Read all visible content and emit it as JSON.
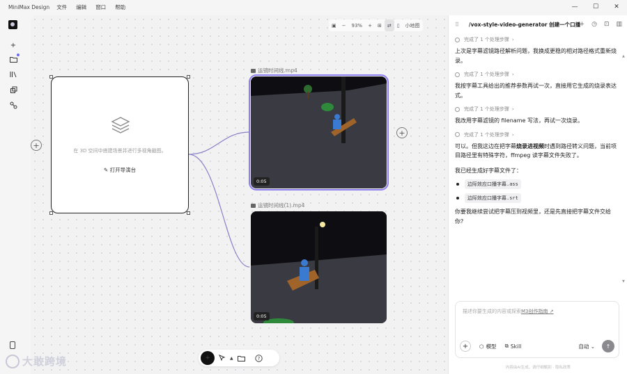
{
  "titlebar": {
    "app_name": "MiniMax Design",
    "menu": [
      "文件",
      "编辑",
      "窗口",
      "帮助"
    ],
    "controls": {
      "minimize": "—",
      "maximize": "☐",
      "close": "✕"
    }
  },
  "rail": {
    "icons": [
      "add-icon",
      "folder-icon",
      "library-icon",
      "puzzle-icon",
      "nodes-icon",
      "phone-icon"
    ]
  },
  "canvas": {
    "zoom": {
      "level": "93%",
      "minus": "−",
      "plus": "+",
      "minimap_label": "小地图"
    },
    "node_3d": {
      "description": "在 3D 空间中搭建场景并进行多视角截图。",
      "open_button": "打开导演台"
    },
    "videos": [
      {
        "label": "运镜时间线.mp4",
        "duration": "0:05",
        "selected": true
      },
      {
        "label": "运镜时间线(1).mp4",
        "duration": "0:05",
        "selected": false
      }
    ]
  },
  "watermark": {
    "text": "大敢跨境"
  },
  "panel": {
    "title": "/vox-style-video-generator 创建一个口播视频",
    "step_label": "完成了 1 个处理步骤",
    "step_chevron": "›",
    "messages": [
      {
        "text": "上次是字幕滤镜路径解析问题，我换成更稳的相对路径格式重新烧录。"
      },
      {
        "text": "我按字幕工具给出的推荐参数再试一次，直接用它生成的烧录表达式。"
      },
      {
        "text": "我改用字幕滤镜的 filename 写法，再试一次烧录。"
      },
      {
        "text_before": "可以。但我这边在把字幕",
        "bold": "烧录进视频",
        "text_after": "时遇到路径转义问题，当前项目路径里有特殊字符，ffmpeg 读字幕文件失败了。"
      }
    ],
    "files_intro": "我已经生成好字幕文件了：",
    "files": [
      "边际效应口播字幕.ass",
      "边际效应口播字幕.srt"
    ],
    "question": "你要我继续尝试把字幕压到视频里，还是先直接把字幕文件交给你?",
    "input": {
      "placeholder_before": "描述你要生成的内容或探索",
      "placeholder_link": "M3创作指南 ↗",
      "model_label": "模型",
      "skill_label": "Skill",
      "auto_label": "自动 ⌄",
      "send_label": "↑"
    },
    "disclaimer": "内容由AI生成，请仔细甄别 · 隐私政策"
  },
  "colors": {
    "accent": "#8b7cf0",
    "dark_button": "#111111"
  }
}
